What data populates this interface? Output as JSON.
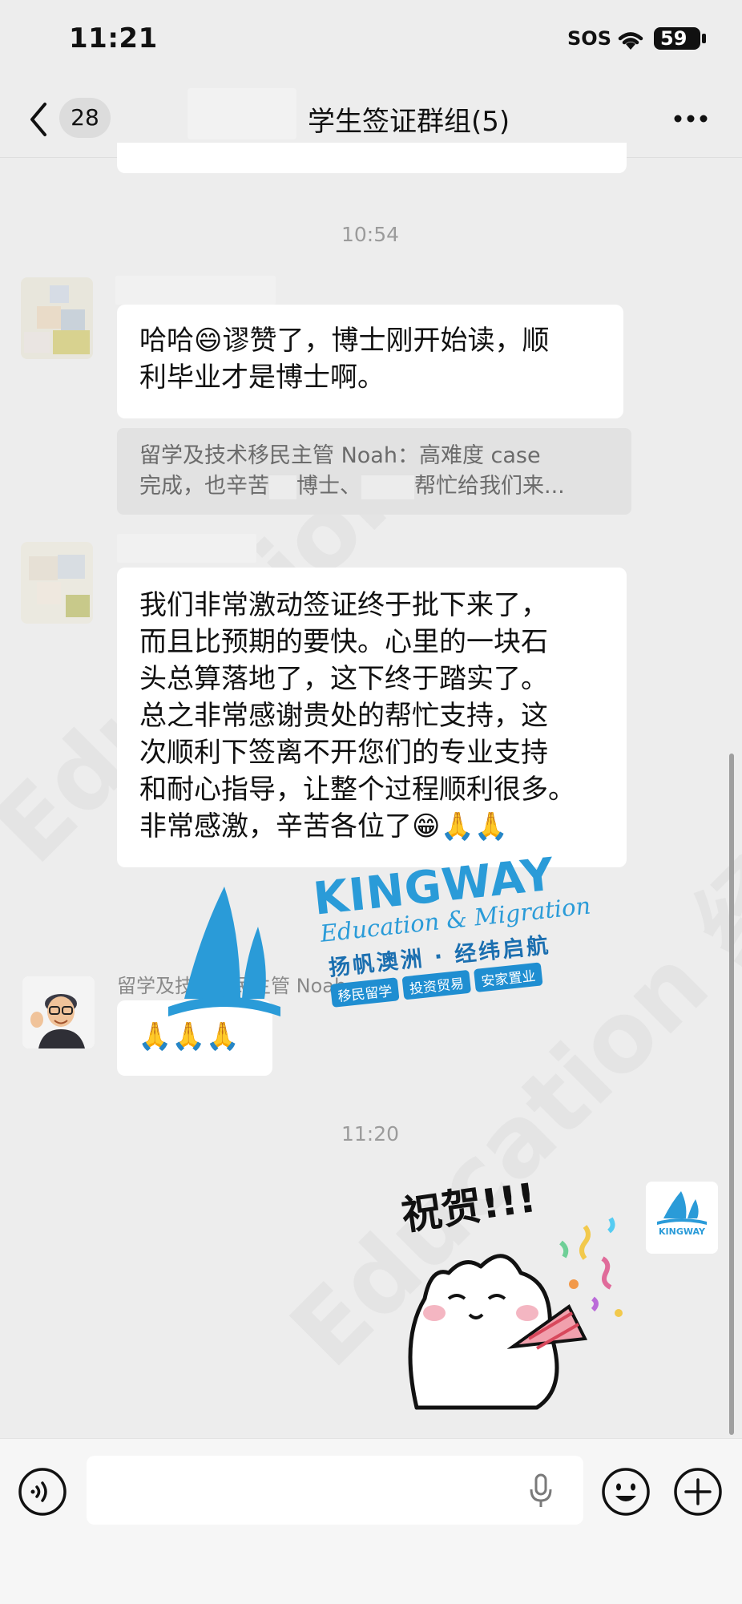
{
  "status_bar": {
    "time": "11:21",
    "sos": "SOS",
    "battery": "59"
  },
  "nav": {
    "back_count": "28",
    "title": "学生签证群组(5)"
  },
  "timestamps": [
    "10:54",
    "11:20"
  ],
  "messages": [
    {
      "text": "哈哈😄谬赞了，博士刚开始读，顺\n利毕业才是博士啊。",
      "quote_line1": "留学及技术移民主管 Noah：高难度 case",
      "quote_line2_part1": "完成，也辛苦",
      "quote_line2_part2": "博士、",
      "quote_line2_part3": "帮忙给我们来..."
    },
    {
      "text": "我们非常激动签证终于批下来了，\n而且比预期的要快。心里的一块石\n头总算落地了，这下终于踏实了。\n总之非常感谢贵处的帮忙支持，这\n次顺利下签离不开您们的专业支持\n和耐心指导，让整个过程顺利很多。\n非常感激，辛苦各位了😁🙏🙏"
    },
    {
      "sender": "留学及技术移民主管 Noah",
      "text": "🙏🙏🙏"
    }
  ],
  "sticker": {
    "text": "祝贺!!!"
  },
  "watermark": {
    "brand": "KINGWAY",
    "subtitle": "Education & Migration",
    "slogan": "扬帆澳洲 · 经纬启航",
    "tags": [
      "移民留学",
      "投资贸易",
      "安家置业"
    ]
  },
  "icons": {
    "back": "chevron-left-icon",
    "more": "more-dots-icon",
    "voice": "voice-toggle-icon",
    "mic": "microphone-icon",
    "emoji": "emoji-icon",
    "plus": "plus-icon"
  },
  "colors": {
    "background": "#ededed",
    "bubble": "#ffffff",
    "brand_blue": "#2a9bd8"
  }
}
